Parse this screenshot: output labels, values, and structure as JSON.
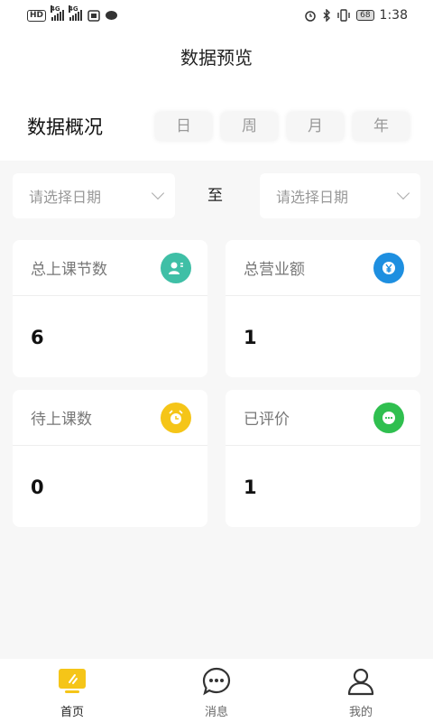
{
  "status_bar": {
    "left_tag": "HD",
    "signal_labels": [
      "4G",
      "4G"
    ],
    "battery": "68",
    "time": "1:38"
  },
  "header": {
    "title": "数据预览"
  },
  "overview": {
    "title": "数据概况",
    "period_tabs": [
      "日",
      "周",
      "月",
      "年"
    ]
  },
  "date_range": {
    "start_placeholder": "请选择日期",
    "separator": "至",
    "end_placeholder": "请选择日期"
  },
  "stats": [
    {
      "label": "总上课节数",
      "value": "6",
      "icon": "student-icon",
      "color": "#3fbfa6"
    },
    {
      "label": "总营业额",
      "value": "1",
      "icon": "yen-coin-icon",
      "color": "#1e8fe0"
    },
    {
      "label": "待上课数",
      "value": "0",
      "icon": "alarm-clock-icon",
      "color": "#f5c518"
    },
    {
      "label": "已评价",
      "value": "1",
      "icon": "chat-icon",
      "color": "#2fbf4f"
    }
  ],
  "bottom_nav": [
    {
      "label": "首页",
      "icon": "home-icon",
      "active": true
    },
    {
      "label": "消息",
      "icon": "message-icon",
      "active": false
    },
    {
      "label": "我的",
      "icon": "profile-icon",
      "active": false
    }
  ]
}
